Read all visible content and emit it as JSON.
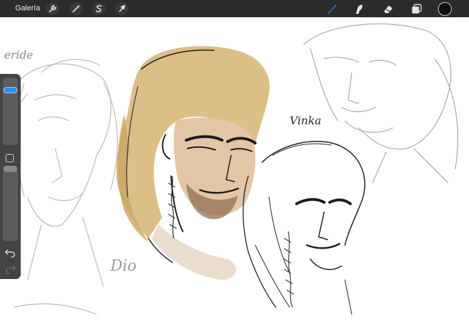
{
  "topbar": {
    "gallery_label": "Galería",
    "left_tools": [
      {
        "name": "actions",
        "icon": "wrench-icon"
      },
      {
        "name": "adjustments",
        "icon": "magic-wand-icon"
      },
      {
        "name": "selection",
        "icon": "selection-s-icon"
      },
      {
        "name": "transform",
        "icon": "arrow-cursor-icon"
      }
    ],
    "right_tools": [
      {
        "name": "brush",
        "icon": "brush-icon",
        "active": true
      },
      {
        "name": "smudge",
        "icon": "smudge-finger-icon"
      },
      {
        "name": "eraser",
        "icon": "eraser-icon"
      },
      {
        "name": "layers",
        "icon": "layers-icon"
      }
    ],
    "current_color": "#0e0e0e",
    "accent": "#2f8cf5"
  },
  "sidebar": {
    "size_level": 0.85,
    "opacity_level": 0.15,
    "undo_icon": "undo-icon",
    "redo_icon": "redo-icon"
  },
  "canvas": {
    "signature_text": "Vinka",
    "sketch_text_1": "eride",
    "sketch_text_2": "Dio"
  }
}
